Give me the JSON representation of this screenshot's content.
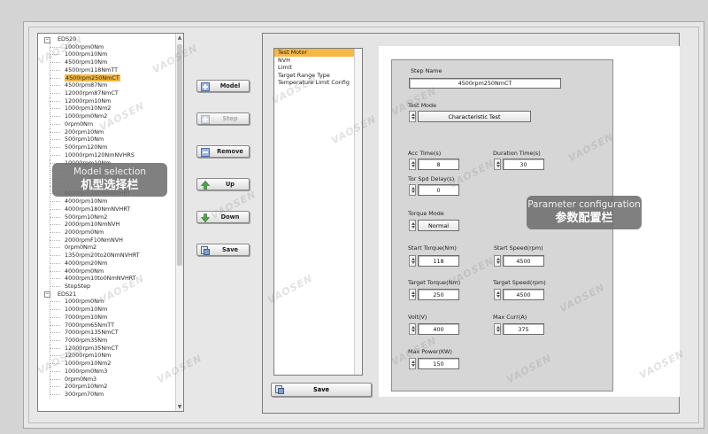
{
  "tree": {
    "groups": [
      {
        "name": "EDS20",
        "items": [
          "1000rpm0Nm",
          "1000rpm10Nm",
          "4500rpm10Nm",
          "4500rpm118NmTT",
          "4500rpm250NmCT",
          "4500rpm87Nm",
          "12000rpm87NmCT",
          "12000rpm10Nm",
          "1000rpm10Nm2",
          "1000rpm0Nm2",
          "0rpm0Nm",
          "200rpm10Nm",
          "500rpm10Nm",
          "500rpm120Nm",
          "10000rpm120NmNVHRS",
          "10000rpm10Nm",
          "",
          "",
          "",
          "4000rpm180NmNVHRT",
          "4000rpm10Nm",
          "4000rpm180NmNVHRT",
          "500rpm10Nm2",
          "2000rpm10NmNVH",
          "2000rpm0Nm",
          "2000rpmF10NmNVH",
          "0rpm0Nm2",
          "1350rpm20to20NmNVHRT",
          "4000rpm20Nm",
          "4000rpm0Nm",
          "4000rpm10to0NmNVHRT",
          "StopStep"
        ]
      },
      {
        "name": "EDS21",
        "items": [
          "1000rpm0Nm",
          "1000rpm10Nm",
          "7000rpm10Nm",
          "7000rpm65NmTT",
          "7000rpm135NmCT",
          "7000rpm35Nm",
          "12000rpm35NmCT",
          "12000rpm10Nm",
          "1000rpm10Nm2",
          "1000rpm0Nm3",
          "0rpm0Nm3",
          "200rpm10Nm2",
          "300rpm70Nm"
        ]
      }
    ],
    "selected_item": "4500rpm250NmCT"
  },
  "buttons": {
    "model": "Model",
    "step": "Step",
    "remove": "Remove",
    "up": "Up",
    "down": "Down",
    "save": "Save",
    "save_right": "Save"
  },
  "steps": {
    "items": [
      "Test Motor",
      "NVH",
      "Limit",
      "Target Range Type",
      "Temperature Limit Config"
    ],
    "selected": "Test Motor"
  },
  "params": {
    "step_name_label": "Step Name",
    "step_name": "4500rpm250NmCT",
    "test_mode_label": "Test Mode",
    "test_mode": "Characteristic Test",
    "acc_time_label": "Acc Time(s)",
    "acc_time": "8",
    "duration_label": "Duration Time(s)",
    "duration": "30",
    "tor_spd_label": "Tor Spd Delay(s)",
    "tor_spd": "0",
    "torque_mode_label": "Torque Mode",
    "torque_mode": "Normal",
    "start_torque_label": "Start Torque(Nm)",
    "start_torque": "118",
    "start_speed_label": "Start Speed(rpm)",
    "start_speed": "4500",
    "target_torque_label": "Target Torque(Nm)",
    "target_torque": "250",
    "target_speed_label": "Target Speed(rpm)",
    "target_speed": "4500",
    "volt_label": "Volt(V)",
    "volt": "400",
    "max_curr_label": "Max Curr(A)",
    "max_curr": "375",
    "max_power_label": "Max Power(KW)",
    "max_power": "150"
  },
  "callouts": {
    "model_en": "Model selection",
    "model_cn": "机型选择栏",
    "param_en": "Parameter configuration",
    "param_cn": "参数配置栏"
  },
  "watermark": "VAOSEN",
  "colors": {
    "selection": "#f5b844"
  }
}
